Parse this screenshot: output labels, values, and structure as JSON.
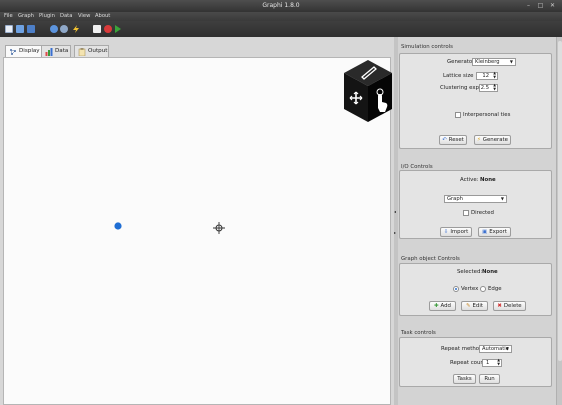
{
  "window": {
    "title": "Graphi 1.8.0",
    "controls": [
      "–",
      "□",
      "✕"
    ]
  },
  "menu": [
    "File",
    "Graph",
    "Plugin",
    "Data",
    "View",
    "About"
  ],
  "toolbar_icons": [
    "new-file-icon",
    "open-folder-icon",
    "save-icon",
    "refresh-icon",
    "search-icon",
    "lightning-icon",
    "document-icon",
    "stop-icon",
    "play-icon"
  ],
  "tabs": [
    {
      "label": "Display"
    },
    {
      "label": "Data"
    },
    {
      "label": "Output"
    }
  ],
  "simulation": {
    "header": "Simulation controls",
    "generator_label": "Generator",
    "generator_value": "Kleinberg",
    "lattice_label": "Lattice size",
    "lattice_value": "12",
    "clustering_label": "Clustering exp.",
    "clustering_value": "2.5",
    "ties_label": "Interpersonal ties",
    "reset_label": "Reset",
    "generate_label": "Generate"
  },
  "io": {
    "header": "I/O Controls",
    "active_label": "Active:",
    "active_value": "None",
    "type_value": "Graph",
    "directed_label": "Directed",
    "import_label": "Import",
    "export_label": "Export"
  },
  "graph_object": {
    "header": "Graph object Controls",
    "selected_label": "Selected:",
    "selected_value": "None",
    "vertex_label": "Vertex",
    "edge_label": "Edge",
    "add_label": "Add",
    "edit_label": "Edit",
    "delete_label": "Delete"
  },
  "tasks": {
    "header": "Task controls",
    "repeat_method_label": "Repeat method",
    "repeat_method_value": "Automatic",
    "repeat_count_label": "Repeat count",
    "repeat_count_value": "1",
    "tasks_label": "Tasks",
    "run_label": "Run"
  },
  "colors": {
    "vertex": "#1f6ed4",
    "nav_cube": "#111111"
  }
}
